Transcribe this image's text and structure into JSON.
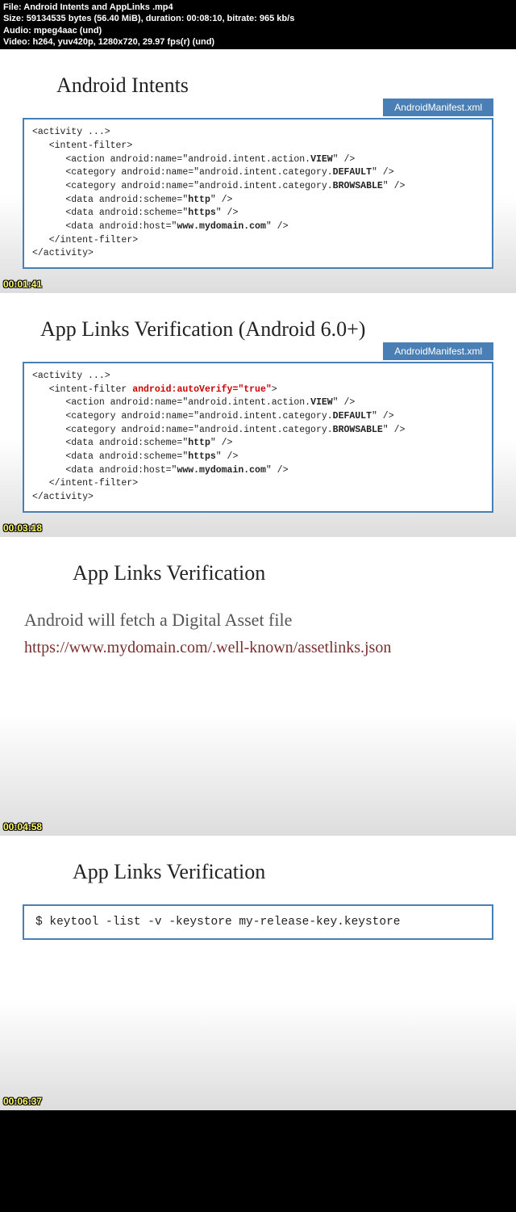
{
  "header": {
    "file": "File: Android Intents and AppLinks .mp4",
    "size": "Size: 59134535 bytes (56.40 MiB), duration: 00:08:10, bitrate: 965 kb/s",
    "audio": "Audio: mpeg4aac (und)",
    "video": "Video: h264, yuv420p, 1280x720, 29.97 fps(r) (und)"
  },
  "slide1": {
    "title": "Android Intents",
    "tab": "AndroidManifest.xml",
    "timestamp": "00:01:41"
  },
  "slide2": {
    "title": "App Links Verification (Android 6.0+)",
    "tab": "AndroidManifest.xml",
    "timestamp": "00:03:18"
  },
  "slide3": {
    "title": "App Links Verification",
    "subtext": "Android will fetch a Digital Asset file",
    "url": "https://www.mydomain.com/.well-known/assetlinks.json",
    "timestamp": "00:04:58"
  },
  "slide4": {
    "title": "App Links Verification",
    "cmd": "$ keytool -list -v -keystore my-release-key.keystore",
    "timestamp": "00:06:37"
  }
}
